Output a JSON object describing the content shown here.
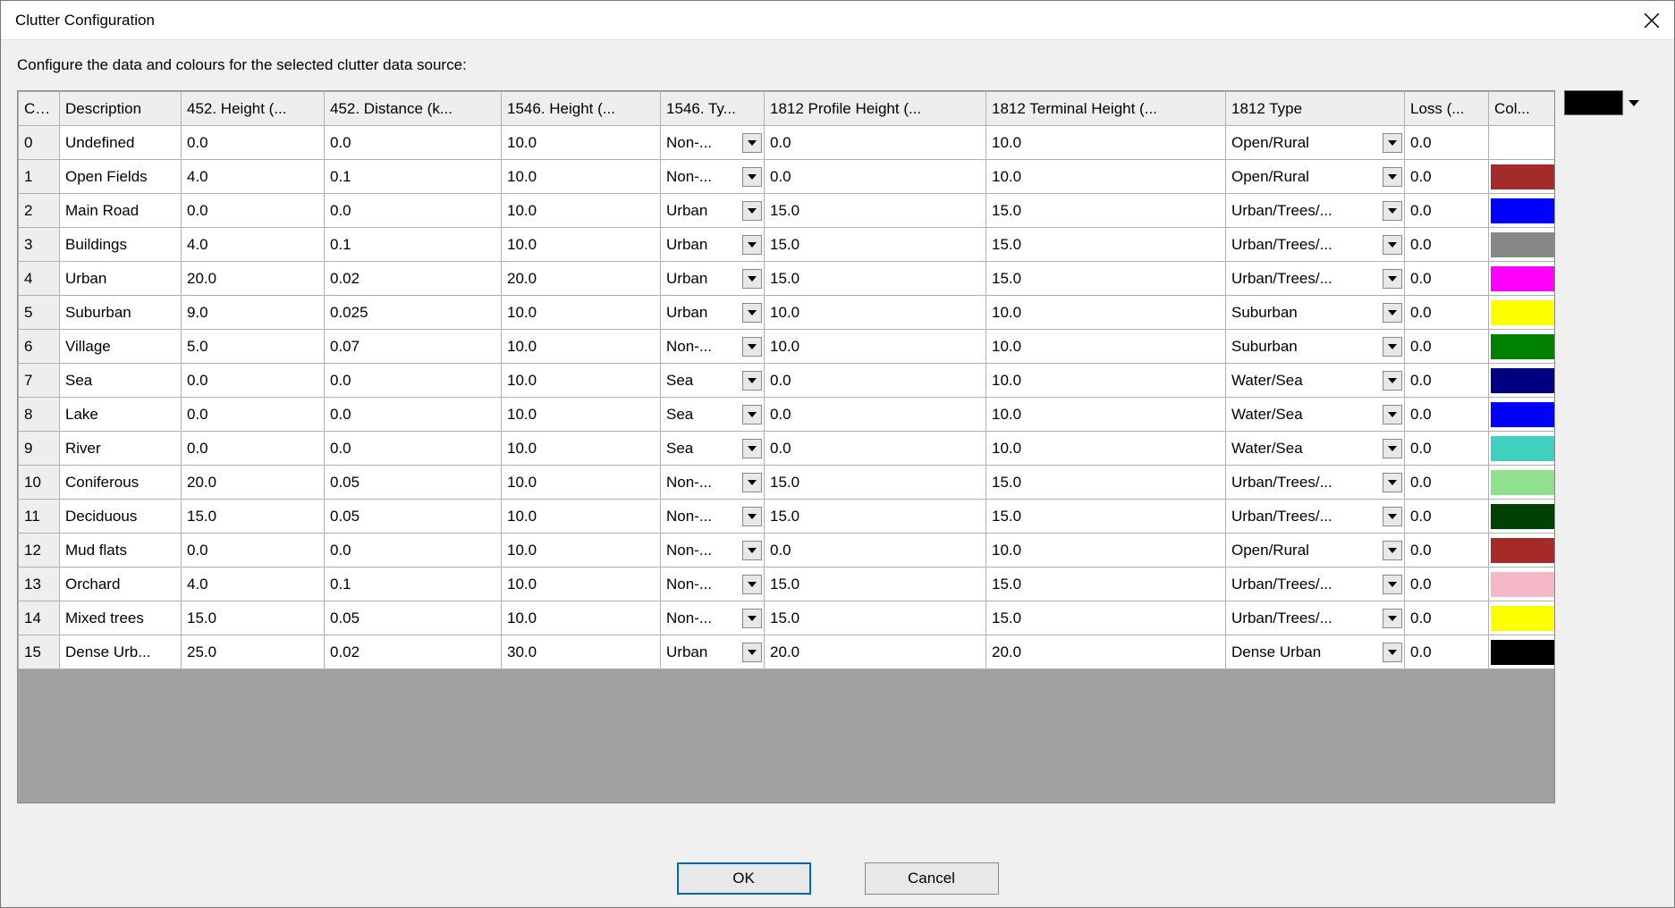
{
  "window": {
    "title": "Clutter Configuration"
  },
  "subtitle": "Configure the data and colours for the selected clutter data source:",
  "picker_color": "#000000",
  "columns": [
    "Co...",
    "Description",
    "452. Height (...",
    "452. Distance (k...",
    "1546. Height (...",
    "1546. Ty...",
    "1812 Profile Height (...",
    "1812 Terminal Height (...",
    "1812 Type",
    "Loss (...",
    "Col..."
  ],
  "rows": [
    {
      "code": "0",
      "desc": "Undefined",
      "h452": "0.0",
      "d452": "0.0",
      "h1546": "10.0",
      "t1546": "Non-...",
      "ph1812": "0.0",
      "th1812": "10.0",
      "t1812": "Open/Rural",
      "loss": "0.0",
      "color": "#ffffff"
    },
    {
      "code": "1",
      "desc": "Open Fields",
      "h452": "4.0",
      "d452": "0.1",
      "h1546": "10.0",
      "t1546": "Non-...",
      "ph1812": "0.0",
      "th1812": "10.0",
      "t1812": "Open/Rural",
      "loss": "0.0",
      "color": "#a52a2a"
    },
    {
      "code": "2",
      "desc": "Main Road",
      "h452": "0.0",
      "d452": "0.0",
      "h1546": "10.0",
      "t1546": "Urban",
      "ph1812": "15.0",
      "th1812": "15.0",
      "t1812": "Urban/Trees/...",
      "loss": "0.0",
      "color": "#0000ff"
    },
    {
      "code": "3",
      "desc": "Buildings",
      "h452": "4.0",
      "d452": "0.1",
      "h1546": "10.0",
      "t1546": "Urban",
      "ph1812": "15.0",
      "th1812": "15.0",
      "t1812": "Urban/Trees/...",
      "loss": "0.0",
      "color": "#888888"
    },
    {
      "code": "4",
      "desc": "Urban",
      "h452": "20.0",
      "d452": "0.02",
      "h1546": "20.0",
      "t1546": "Urban",
      "ph1812": "15.0",
      "th1812": "15.0",
      "t1812": "Urban/Trees/...",
      "loss": "0.0",
      "color": "#ff00ff"
    },
    {
      "code": "5",
      "desc": "Suburban",
      "h452": "9.0",
      "d452": "0.025",
      "h1546": "10.0",
      "t1546": "Urban",
      "ph1812": "10.0",
      "th1812": "10.0",
      "t1812": "Suburban",
      "loss": "0.0",
      "color": "#ffff00"
    },
    {
      "code": "6",
      "desc": "Village",
      "h452": "5.0",
      "d452": "0.07",
      "h1546": "10.0",
      "t1546": "Non-...",
      "ph1812": "10.0",
      "th1812": "10.0",
      "t1812": "Suburban",
      "loss": "0.0",
      "color": "#008000"
    },
    {
      "code": "7",
      "desc": "Sea",
      "h452": "0.0",
      "d452": "0.0",
      "h1546": "10.0",
      "t1546": "Sea",
      "ph1812": "0.0",
      "th1812": "10.0",
      "t1812": "Water/Sea",
      "loss": "0.0",
      "color": "#000080"
    },
    {
      "code": "8",
      "desc": "Lake",
      "h452": "0.0",
      "d452": "0.0",
      "h1546": "10.0",
      "t1546": "Sea",
      "ph1812": "0.0",
      "th1812": "10.0",
      "t1812": "Water/Sea",
      "loss": "0.0",
      "color": "#0000ff"
    },
    {
      "code": "9",
      "desc": "River",
      "h452": "0.0",
      "d452": "0.0",
      "h1546": "10.0",
      "t1546": "Sea",
      "ph1812": "0.0",
      "th1812": "10.0",
      "t1812": "Water/Sea",
      "loss": "0.0",
      "color": "#40d0c0"
    },
    {
      "code": "10",
      "desc": "Coniferous",
      "h452": "20.0",
      "d452": "0.05",
      "h1546": "10.0",
      "t1546": "Non-...",
      "ph1812": "15.0",
      "th1812": "15.0",
      "t1812": "Urban/Trees/...",
      "loss": "0.0",
      "color": "#90e090"
    },
    {
      "code": "11",
      "desc": "Deciduous",
      "h452": "15.0",
      "d452": "0.05",
      "h1546": "10.0",
      "t1546": "Non-...",
      "ph1812": "15.0",
      "th1812": "15.0",
      "t1812": "Urban/Trees/...",
      "loss": "0.0",
      "color": "#004000"
    },
    {
      "code": "12",
      "desc": "Mud flats",
      "h452": "0.0",
      "d452": "0.0",
      "h1546": "10.0",
      "t1546": "Non-...",
      "ph1812": "0.0",
      "th1812": "10.0",
      "t1812": "Open/Rural",
      "loss": "0.0",
      "color": "#a52a2a"
    },
    {
      "code": "13",
      "desc": "Orchard",
      "h452": "4.0",
      "d452": "0.1",
      "h1546": "10.0",
      "t1546": "Non-...",
      "ph1812": "15.0",
      "th1812": "15.0",
      "t1812": "Urban/Trees/...",
      "loss": "0.0",
      "color": "#f5b8c8"
    },
    {
      "code": "14",
      "desc": "Mixed trees",
      "h452": "15.0",
      "d452": "0.05",
      "h1546": "10.0",
      "t1546": "Non-...",
      "ph1812": "15.0",
      "th1812": "15.0",
      "t1812": "Urban/Trees/...",
      "loss": "0.0",
      "color": "#ffff00"
    },
    {
      "code": "15",
      "desc": "Dense Urb...",
      "h452": "25.0",
      "d452": "0.02",
      "h1546": "30.0",
      "t1546": "Urban",
      "ph1812": "20.0",
      "th1812": "20.0",
      "t1812": "Dense Urban",
      "loss": "0.0",
      "color": "#000000"
    }
  ],
  "buttons": {
    "ok": "OK",
    "cancel": "Cancel"
  }
}
